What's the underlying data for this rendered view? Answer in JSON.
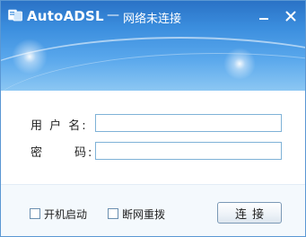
{
  "window": {
    "app_name": "AutoADSL",
    "separator": "—",
    "status": "网络未连接",
    "minimize_glyph": "minus",
    "close_glyph": "x"
  },
  "form": {
    "username_label": "用 户 名:",
    "password_label": "密",
    "password_label_tail": "码:",
    "username_value": "",
    "password_value": ""
  },
  "options": {
    "autostart_label": "开机启动",
    "autostart_checked": false,
    "reconnect_label": "断网重拨",
    "reconnect_checked": false
  },
  "actions": {
    "connect_label": "连接"
  },
  "colors": {
    "banner_top": "#2a72c6",
    "banner_bottom": "#8cc7f3",
    "input_border": "#7fb2d7",
    "window_border": "#5a97d3"
  },
  "icons": [
    "app-logo-icon",
    "minimize-icon",
    "close-icon"
  ]
}
